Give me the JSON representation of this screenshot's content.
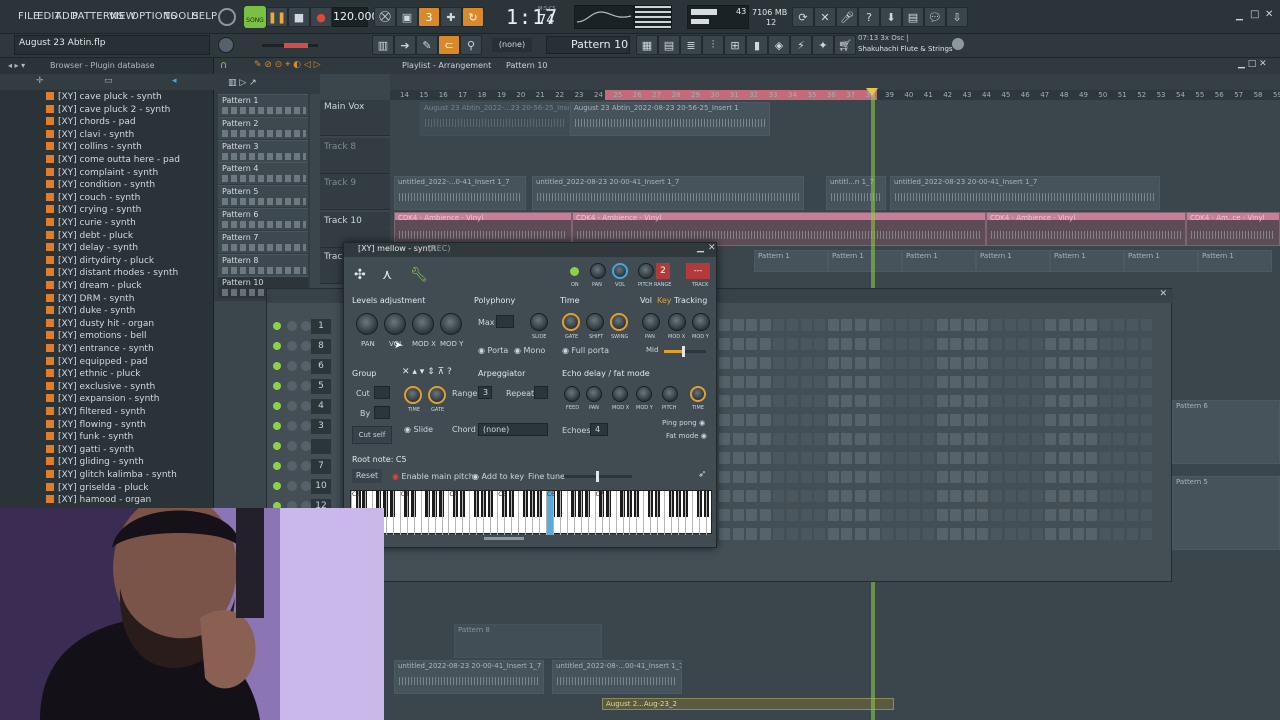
{
  "top": {
    "menu": [
      "FILE",
      "EDIT",
      "ADD",
      "PATTERNS",
      "VIEW",
      "OPTIONS",
      "TOOLS",
      "HELP"
    ],
    "song_label": "SONG",
    "tempo": "120.000",
    "time": "1:17",
    "time_ms": "74",
    "time_unit": "M:S:CS",
    "cpu": "43",
    "mem": "7106 MB",
    "voices": "12",
    "project_name": "August 23 Abtin.flp",
    "snap": "(none)",
    "pattern": "Pattern 10",
    "hint_line1": "07:13  3x Osc |",
    "hint_line2": "Shakuhachi Flute & Strings"
  },
  "browser": {
    "title": "Browser - Plugin database",
    "items": [
      "[XY] cave pluck - synth",
      "[XY] cave pluck 2 - synth",
      "[XY] chords - pad",
      "[XY] clavi - synth",
      "[XY] collins - synth",
      "[XY] come outta here - pad",
      "[XY] complaint - synth",
      "[XY] condition - synth",
      "[XY] couch - synth",
      "[XY] crying - synth",
      "[XY] curie - synth",
      "[XY] debt - pluck",
      "[XY] delay - synth",
      "[XY] dirtydirty - pluck",
      "[XY] distant rhodes - synth",
      "[XY] dream - pluck",
      "[XY] DRM - synth",
      "[XY] duke - synth",
      "[XY] dusty hit - organ",
      "[XY] emotions - bell",
      "[XY] entrance - synth",
      "[XY] equipped - pad",
      "[XY] ethnic - pluck",
      "[XY] exclusive - synth",
      "[XY] expansion - synth",
      "[XY] filtered - synth",
      "[XY] flowing - synth",
      "[XY] funk - synth",
      "[XY] gatti - synth",
      "[XY] gliding - synth",
      "[XY] glitch kalimba - synth",
      "[XY] griselda - pluck",
      "[XY] hamood - organ"
    ]
  },
  "playlist": {
    "title": "Playlist - Arrangement",
    "current_pattern": "Pattern 10",
    "patterns": [
      "Pattern 1",
      "Pattern 2",
      "Pattern 3",
      "Pattern 4",
      "Pattern 5",
      "Pattern 6",
      "Pattern 7",
      "Pattern 8",
      "Pattern 10"
    ],
    "tracks": [
      "Main Vox",
      "Track 8",
      "Track 9",
      "Track 10",
      "Track"
    ],
    "ruler": [
      "14",
      "15",
      "16",
      "17",
      "18",
      "19",
      "20",
      "21",
      "22",
      "23",
      "24",
      "25",
      "26",
      "27",
      "28",
      "29",
      "30",
      "31",
      "32",
      "33",
      "34",
      "35",
      "36",
      "37",
      "38",
      "39",
      "40",
      "41",
      "42",
      "43",
      "44",
      "45",
      "46",
      "47",
      "48",
      "49",
      "50",
      "51",
      "52",
      "53",
      "54",
      "55",
      "56",
      "57",
      "58",
      "59"
    ],
    "clips": {
      "vox_a": "August 23 Abtin_2022-...23 20-56-25_Insert 1",
      "vox_b": "August 23 Abtin_2022-08-23 20-56-25_Insert 1",
      "t9_a": "untitled_2022-...0-41_Insert 1_7",
      "t9_b": "untitled_2022-08-23 20-00-41_Insert 1_7",
      "t9_c": "untitl...n 1_7",
      "t9_d": "untitled_2022-08-23 20-00-41_Insert 1_7",
      "amb": "CDK4 - Ambience - Vinyl",
      "amb2": "CDK4 - Am..ce - Vinyl",
      "pat1": "Pattern 1",
      "pat6": "Pattern 6",
      "pat5": "Pattern 5",
      "pat8": "Pattern 8",
      "bot_a": "untitled_2022-08-23 20-00-41_Insert 1_7",
      "bot_b": "untitled_2022-08-...00-41_Insert 1_7",
      "aug": "August 2...Aug-23_2"
    }
  },
  "plugin": {
    "title": "[XY] mellow - synth",
    "rec": "(REC)",
    "top_labels": [
      "ON",
      "PAN",
      "VOL",
      "PITCH",
      "RANGE",
      "TRACK"
    ],
    "range_value": "2",
    "levels": "Levels adjustment",
    "levels_knobs": [
      "PAN",
      "VOL",
      "MOD X",
      "MOD Y"
    ],
    "polyphony": "Polyphony",
    "max": "Max",
    "slide": "SLIDE",
    "porta": "Porta",
    "mono": "Mono",
    "time": "Time",
    "time_knobs": [
      "GATE",
      "SHIFT",
      "SWING"
    ],
    "full_porta": "Full porta",
    "vol": "Vol",
    "key": "Key",
    "tracking": "Tracking",
    "track_knobs": [
      "PAN",
      "MOD X",
      "MOD Y"
    ],
    "mid": "Mid",
    "group": "Group",
    "cut": "Cut",
    "by": "By",
    "cut_self": "Cut self",
    "arpeggiator": "Arpeggiator",
    "arp_knobs": [
      "TIME",
      "GATE"
    ],
    "range_label": "Range",
    "range": "3",
    "repeat": "Repeat",
    "slide2": "Slide",
    "chord": "Chord",
    "chord_value": "(none)",
    "echo": "Echo delay / fat mode",
    "echo_knobs": [
      "FEED",
      "PAN",
      "MOD X",
      "MOD Y",
      "PITCH",
      "TIME"
    ],
    "echoes": "Echoes",
    "echoes_value": "4",
    "ping_pong": "Ping pong",
    "fat_mode": "Fat mode",
    "root_note": "Root note: C5",
    "reset": "Reset",
    "enable_main_pitch": "Enable main pitch",
    "add_to_key": "Add to key",
    "fine_tune": "Fine tune",
    "octaves": [
      "C2",
      "C3",
      "C4",
      "C5",
      "C6",
      "C7"
    ]
  },
  "channel_rack": {
    "numbers": [
      "1",
      "8",
      "6",
      "5",
      "4",
      "3",
      "",
      "7",
      "10",
      "12"
    ]
  },
  "colors": {
    "accent": "#e0892a",
    "pink": "#c87e99",
    "playhead": "#8fd04a"
  }
}
